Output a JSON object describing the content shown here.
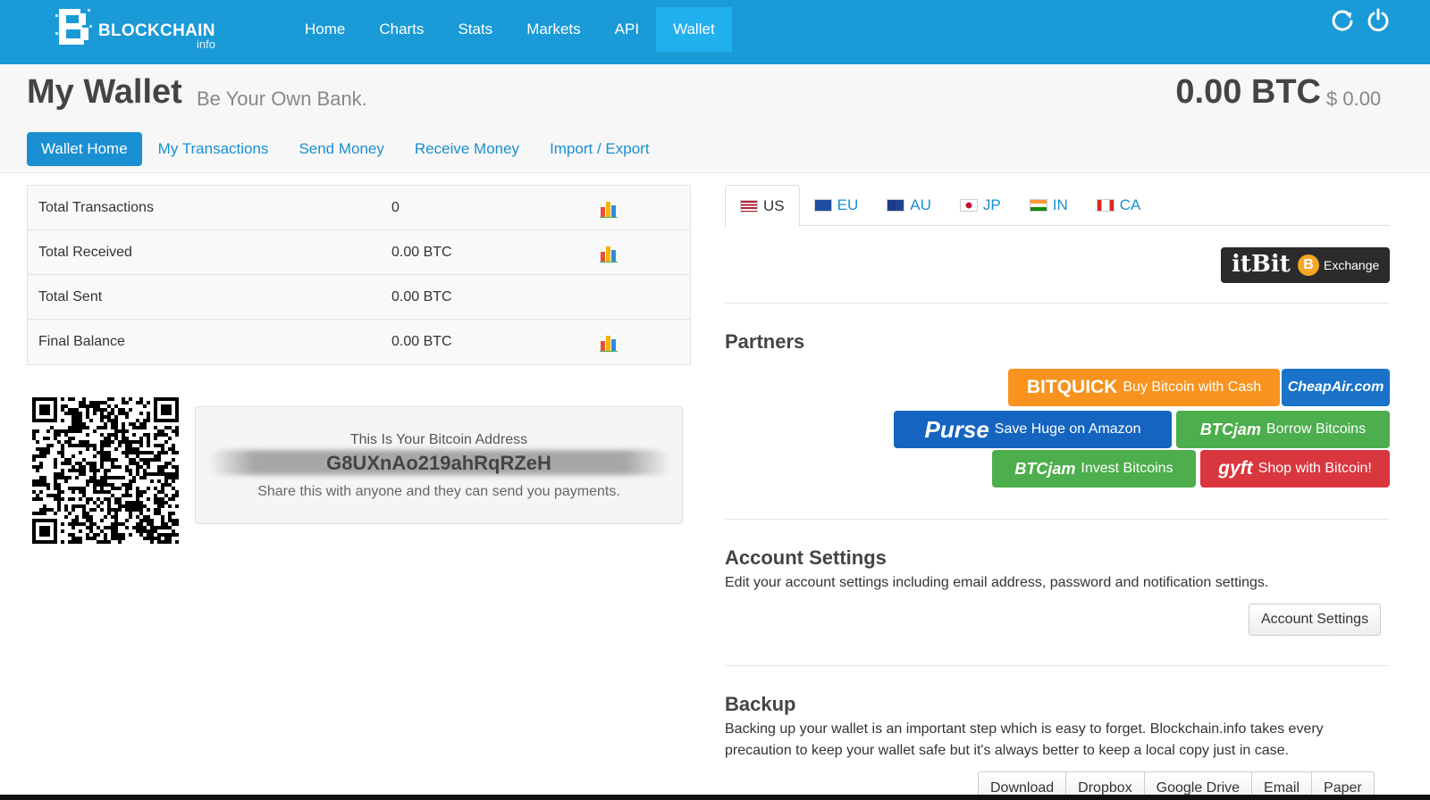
{
  "brand": {
    "name": "BLOCKCHAIN",
    "sub": "info"
  },
  "nav": {
    "items": [
      {
        "label": "Home"
      },
      {
        "label": "Charts"
      },
      {
        "label": "Stats"
      },
      {
        "label": "Markets"
      },
      {
        "label": "API"
      },
      {
        "label": "Wallet",
        "active": true
      }
    ],
    "icons": [
      "refresh-icon",
      "power-icon"
    ]
  },
  "header": {
    "title": "My Wallet",
    "subtitle": "Be Your Own Bank.",
    "balance_btc": "0.00 BTC",
    "balance_usd": "$ 0.00"
  },
  "subnav": {
    "items": [
      {
        "label": "Wallet Home",
        "active": true
      },
      {
        "label": "My Transactions"
      },
      {
        "label": "Send Money"
      },
      {
        "label": "Receive Money"
      },
      {
        "label": "Import / Export"
      }
    ]
  },
  "stats": [
    {
      "label": "Total Transactions",
      "value": "0",
      "chart": true
    },
    {
      "label": "Total Received",
      "value": "0.00 BTC",
      "chart": true
    },
    {
      "label": "Total Sent",
      "value": "0.00 BTC",
      "chart": false
    },
    {
      "label": "Final Balance",
      "value": "0.00 BTC",
      "chart": true
    }
  ],
  "address": {
    "title": "This Is Your Bitcoin Address",
    "visible_fragment": "G8UXnAo219ahRqRZeH",
    "note": "Share this with anyone and they can send you payments."
  },
  "regions": [
    {
      "label": "US",
      "active": true
    },
    {
      "label": "EU"
    },
    {
      "label": "AU"
    },
    {
      "label": "JP"
    },
    {
      "label": "IN"
    },
    {
      "label": "CA"
    }
  ],
  "itbit": {
    "brand": "itBit",
    "coin": "B",
    "label": "Exchange"
  },
  "partners": {
    "title": "Partners",
    "items": [
      {
        "brand": "BITQUICK",
        "text": "Buy Bitcoin with Cash",
        "color": "#f7931e"
      },
      {
        "brand": "CheapAir.com",
        "text": "",
        "color": "#1a73c8"
      },
      {
        "brand": "Purse",
        "text": "Save Huge on Amazon",
        "color": "#1565c0"
      },
      {
        "brand": "BTCjam",
        "text": "Borrow Bitcoins",
        "color": "#4cae4c"
      },
      {
        "brand": "BTCjam",
        "text": "Invest Bitcoins",
        "color": "#4cae4c"
      },
      {
        "brand": "gyft",
        "text": "Shop with Bitcoin!",
        "color": "#d9363e"
      }
    ]
  },
  "account": {
    "title": "Account Settings",
    "text": "Edit your account settings including email address, password and notification settings.",
    "button": "Account Settings"
  },
  "backup": {
    "title": "Backup",
    "text": "Backing up your wallet is an important step which is easy to forget. Blockchain.info takes every precaution to keep your wallet safe but it's always better to keep a local copy just in case.",
    "buttons": [
      "Download",
      "Dropbox",
      "Google Drive",
      "Email",
      "Paper"
    ]
  },
  "colors": {
    "nav_bg": "#1a9ad6",
    "nav_active": "#21b0ee",
    "link": "#1a8fd2"
  }
}
